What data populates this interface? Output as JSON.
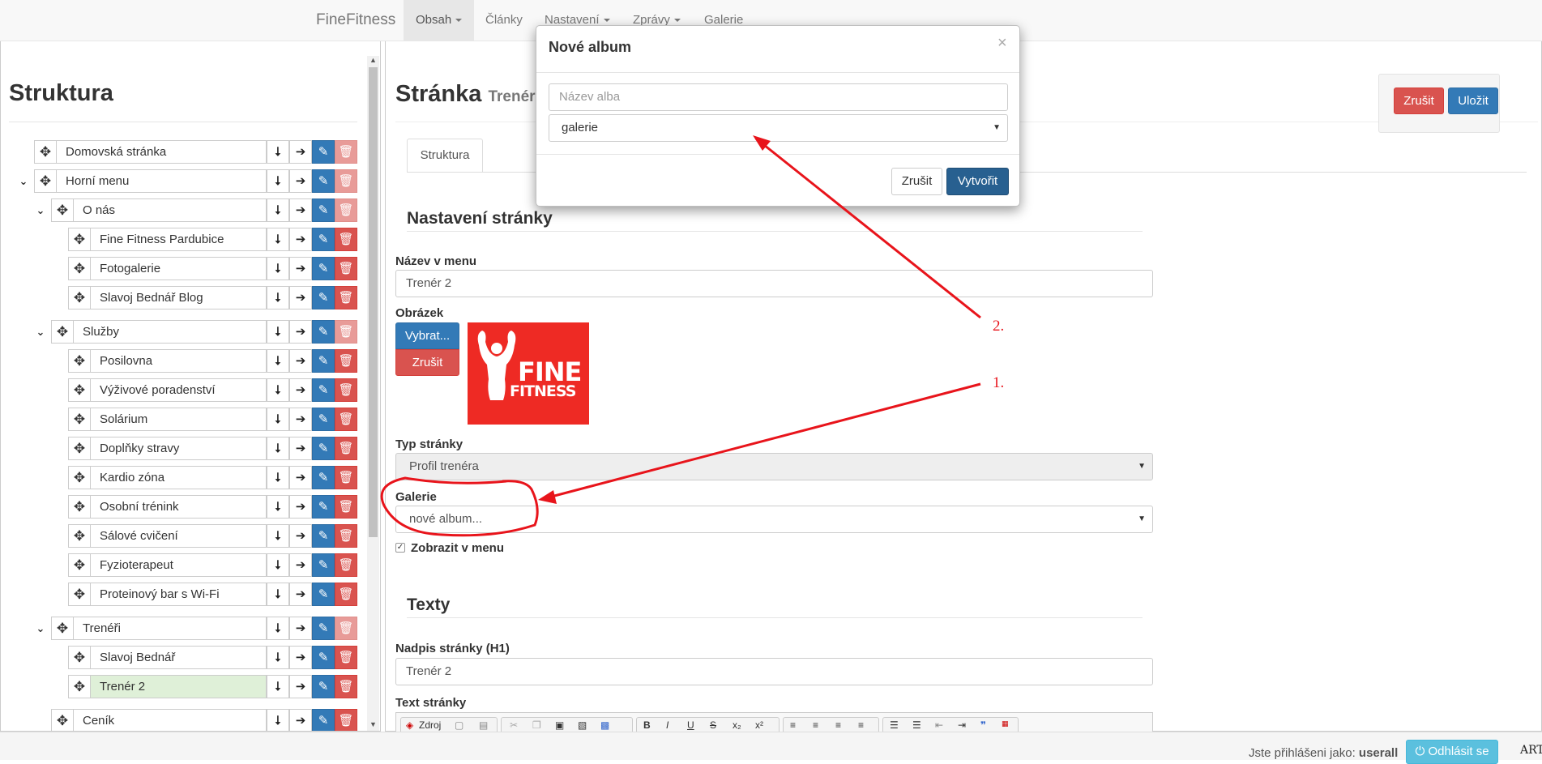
{
  "navbar": {
    "brand": "FineFitness",
    "items": [
      {
        "label": "Obsah",
        "dropdown": true,
        "active": true
      },
      {
        "label": "Články",
        "dropdown": false
      },
      {
        "label": "Nastavení",
        "dropdown": true
      },
      {
        "label": "Zprávy",
        "dropdown": true
      },
      {
        "label": "Galerie",
        "dropdown": false
      }
    ]
  },
  "structure": {
    "title": "Struktura",
    "items": [
      {
        "label": "Domovská stránka",
        "level": 0,
        "expandable": false,
        "delete_disabled": true
      },
      {
        "label": "Horní menu",
        "level": 0,
        "expandable": true,
        "delete_disabled": true
      },
      {
        "label": "O nás",
        "level": 1,
        "expandable": true,
        "delete_disabled": true
      },
      {
        "label": "Fine Fitness Pardubice",
        "level": 2
      },
      {
        "label": "Fotogalerie",
        "level": 2
      },
      {
        "label": "Slavoj Bednář Blog",
        "level": 2
      },
      {
        "label": "Služby",
        "level": 1,
        "expandable": true,
        "delete_disabled": true
      },
      {
        "label": "Posilovna",
        "level": 2
      },
      {
        "label": "Výživové poradenství",
        "level": 2
      },
      {
        "label": "Solárium",
        "level": 2
      },
      {
        "label": "Doplňky stravy",
        "level": 2
      },
      {
        "label": "Kardio zóna",
        "level": 2
      },
      {
        "label": "Osobní trénink",
        "level": 2
      },
      {
        "label": "Sálové cvičení",
        "level": 2
      },
      {
        "label": "Fyzioterapeut",
        "level": 2
      },
      {
        "label": "Proteinový bar s Wi-Fi",
        "level": 2
      },
      {
        "label": "Trenéři",
        "level": 1,
        "expandable": true,
        "delete_disabled": true
      },
      {
        "label": "Slavoj Bednář",
        "level": 2
      },
      {
        "label": "Trenér 2",
        "level": 2,
        "selected": true
      },
      {
        "label": "Ceník",
        "level": 1,
        "expandable": false
      }
    ]
  },
  "page": {
    "title": "Stránka",
    "subtitle": "Trenér 2",
    "cancel_label": "Zrušit",
    "save_label": "Uložit",
    "tab_label": "Struktura",
    "settings_heading": "Nastavení stránky",
    "menu_name_label": "Název v menu",
    "menu_name_value": "Trenér 2",
    "image_label": "Obrázek",
    "select_image_label": "Vybrat...",
    "remove_image_label": "Zrušit",
    "page_type_label": "Typ stránky",
    "page_type_value": "Profil trenéra",
    "gallery_label": "Galerie",
    "gallery_value": "nové album...",
    "show_in_menu_label": "Zobrazit v menu",
    "texts_heading": "Texty",
    "h1_label": "Nadpis stránky (H1)",
    "h1_value": "Trenér 2",
    "page_text_label": "Text stránky",
    "editor_source_label": "Zdroj"
  },
  "logo": {
    "line1": "FINE",
    "line2": "FITNESS",
    "color": "#ee2a24"
  },
  "modal": {
    "title": "Nové album",
    "name_placeholder": "Název alba",
    "category_value": "galerie",
    "cancel_label": "Zrušit",
    "create_label": "Vytvořit"
  },
  "annotations": {
    "first": "1.",
    "second": "2.",
    "color": "#e8141b"
  },
  "footer": {
    "logged_in_text": "Jste přihlášeni jako:",
    "username": "userall",
    "logout_label": "Odhlásit se",
    "logo_text": "ART"
  }
}
